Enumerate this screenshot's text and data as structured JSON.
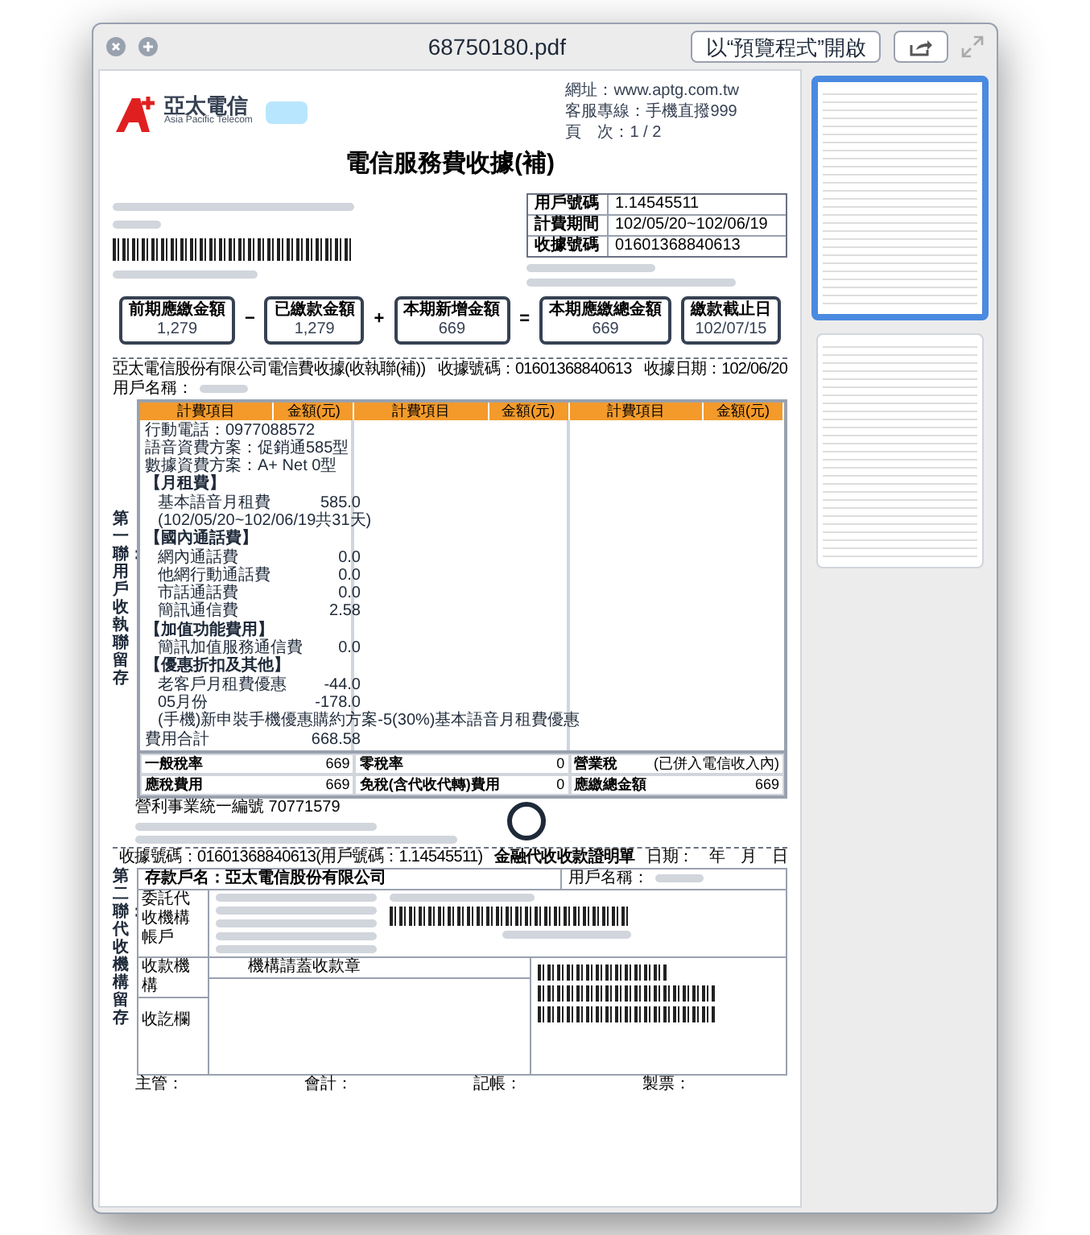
{
  "window": {
    "title": "68750180.pdf",
    "open_button": "以“預覽程式”開啟"
  },
  "document": {
    "header": {
      "logo_text": "亞太電信",
      "logo_subtext": "Asia Pacific Telecom",
      "website": "網址：www.aptg.com.tw",
      "hotline": "客服專線：手機直撥999",
      "page": "頁　次：1 / 2",
      "title": "電信服務費收據(補)"
    },
    "account_info": [
      {
        "label": "用戶號碼",
        "value": "1.14545511"
      },
      {
        "label": "計費期間",
        "value": "102/05/20~102/06/19"
      },
      {
        "label": "收據號碼",
        "value": "01601368840613"
      }
    ],
    "summary": [
      {
        "label": "前期應繳金額",
        "value": "1,279",
        "operator": "−"
      },
      {
        "label": "已繳款金額",
        "value": "1,279",
        "operator": "+"
      },
      {
        "label": "本期新增金額",
        "value": "669",
        "operator": "="
      },
      {
        "label": "本期應繳總金額",
        "value": "669"
      },
      {
        "label": "繳款截止日",
        "value": "102/07/15"
      }
    ],
    "receipt": {
      "company_line": "亞太電信股份有限公司電信費收據(收執聯(補))",
      "receipt_no": "收據號碼：01601368840613",
      "receipt_date": "收據日期：102/06/20",
      "customer_label": "用戶名稱：",
      "side_label": "第一聯：用戶收執聯留存",
      "columns": [
        "計費項目",
        "金額(元)",
        "計費項目",
        "金額(元)",
        "計費項目",
        "金額(元)"
      ],
      "rows": [
        {
          "kind": "line",
          "text": "行動電話：0977088572"
        },
        {
          "kind": "line",
          "text": "語音資費方案：促銷通585型"
        },
        {
          "kind": "line",
          "text": "數據資費方案：A+ Net 0型"
        },
        {
          "kind": "section",
          "text": "【月租費】"
        },
        {
          "kind": "item",
          "text": "基本語音月租費",
          "amount": "585.0"
        },
        {
          "kind": "item",
          "text": "(102/05/20~102/06/19共31天)"
        },
        {
          "kind": "section",
          "text": "【國內通話費】"
        },
        {
          "kind": "item",
          "text": "網內通話費",
          "amount": "0.0"
        },
        {
          "kind": "item",
          "text": "他網行動通話費",
          "amount": "0.0"
        },
        {
          "kind": "item",
          "text": "市話通話費",
          "amount": "0.0"
        },
        {
          "kind": "item",
          "text": "簡訊通信費",
          "amount": "2.58"
        },
        {
          "kind": "section",
          "text": "【加值功能費用】"
        },
        {
          "kind": "item",
          "text": "簡訊加值服務通信費",
          "amount": "0.0"
        },
        {
          "kind": "section",
          "text": "【優惠折扣及其他】"
        },
        {
          "kind": "item",
          "text": "老客戶月租費優惠",
          "amount": "-44.0"
        },
        {
          "kind": "item",
          "text": "05月份",
          "amount": "-178.0"
        },
        {
          "kind": "item",
          "text": "(手機)新申裝手機優惠購約方案-5(30%)基本語音月租費優惠"
        },
        {
          "kind": "line",
          "text": "費用合計",
          "amount": "668.58"
        }
      ],
      "totals": [
        {
          "label": "一般稅率",
          "value": "669"
        },
        {
          "label": "零稅率",
          "value": "0"
        },
        {
          "label": "營業稅",
          "value": "(已併入電信收入內)"
        },
        {
          "label": "應稅費用",
          "value": "669"
        },
        {
          "label": "免稅(含代收代轉)費用",
          "value": "0"
        },
        {
          "label": "應繳總金額",
          "value": "669"
        }
      ],
      "notes": [
        "營利事業統一編號 70771579"
      ]
    },
    "payment_slip": {
      "receipt_no": "收據號碼：01601368840613(用戶號碼：1.14545511)",
      "title": "金融代收收款證明單",
      "date": "日期：　年　月　日",
      "account_name": "存款戶名：亞太電信股份有限公司",
      "customer_label": "用戶名稱：",
      "side_label": "第二聯：代收機構留存",
      "agency_label": "委託代收機構帳戶",
      "institution_label": "收款機構",
      "stamp_hint": "機構請蓋收款章",
      "received_label": "收訖欄",
      "signatures": [
        "主管：",
        "會計：",
        "記帳：",
        "製票："
      ]
    }
  },
  "thumbnails": [
    {
      "selected": true
    },
    {
      "selected": false
    }
  ]
}
